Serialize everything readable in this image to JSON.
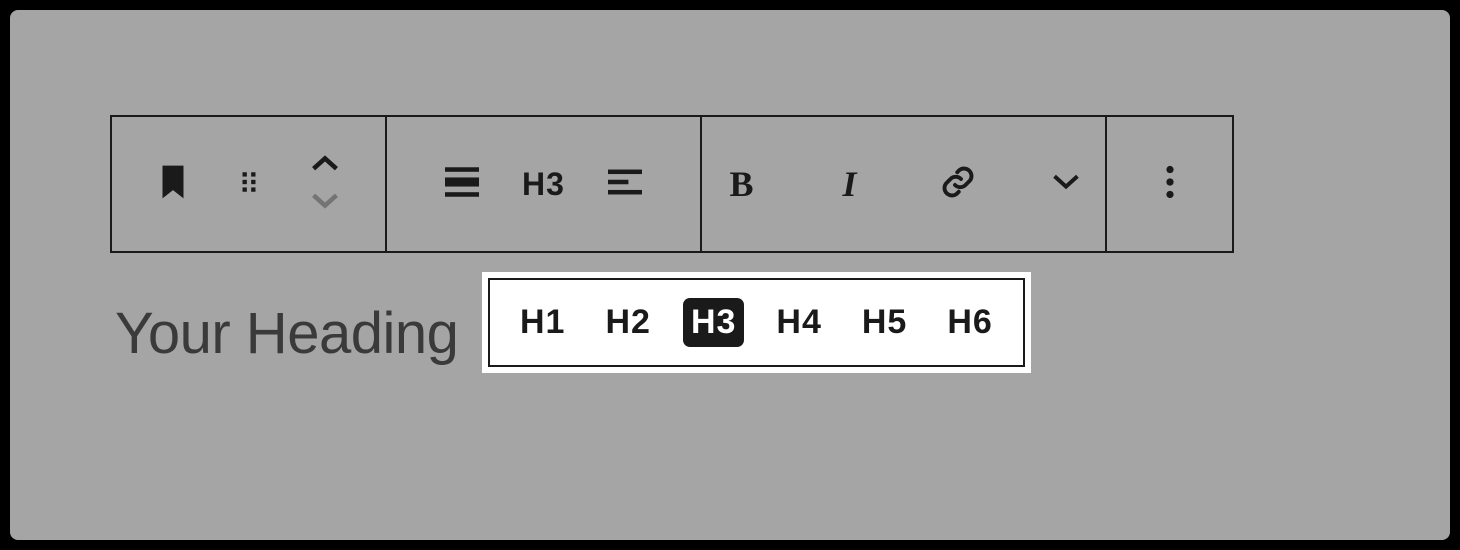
{
  "heading": {
    "placeholder": "Your Heading",
    "current_level": "H3"
  },
  "toolbar": {
    "heading_level_label": "H3",
    "bold_label": "B",
    "italic_label": "I"
  },
  "heading_popover": {
    "options": [
      {
        "label": "H1",
        "selected": false
      },
      {
        "label": "H2",
        "selected": false
      },
      {
        "label": "H3",
        "selected": true
      },
      {
        "label": "H4",
        "selected": false
      },
      {
        "label": "H5",
        "selected": false
      },
      {
        "label": "H6",
        "selected": false
      }
    ]
  }
}
